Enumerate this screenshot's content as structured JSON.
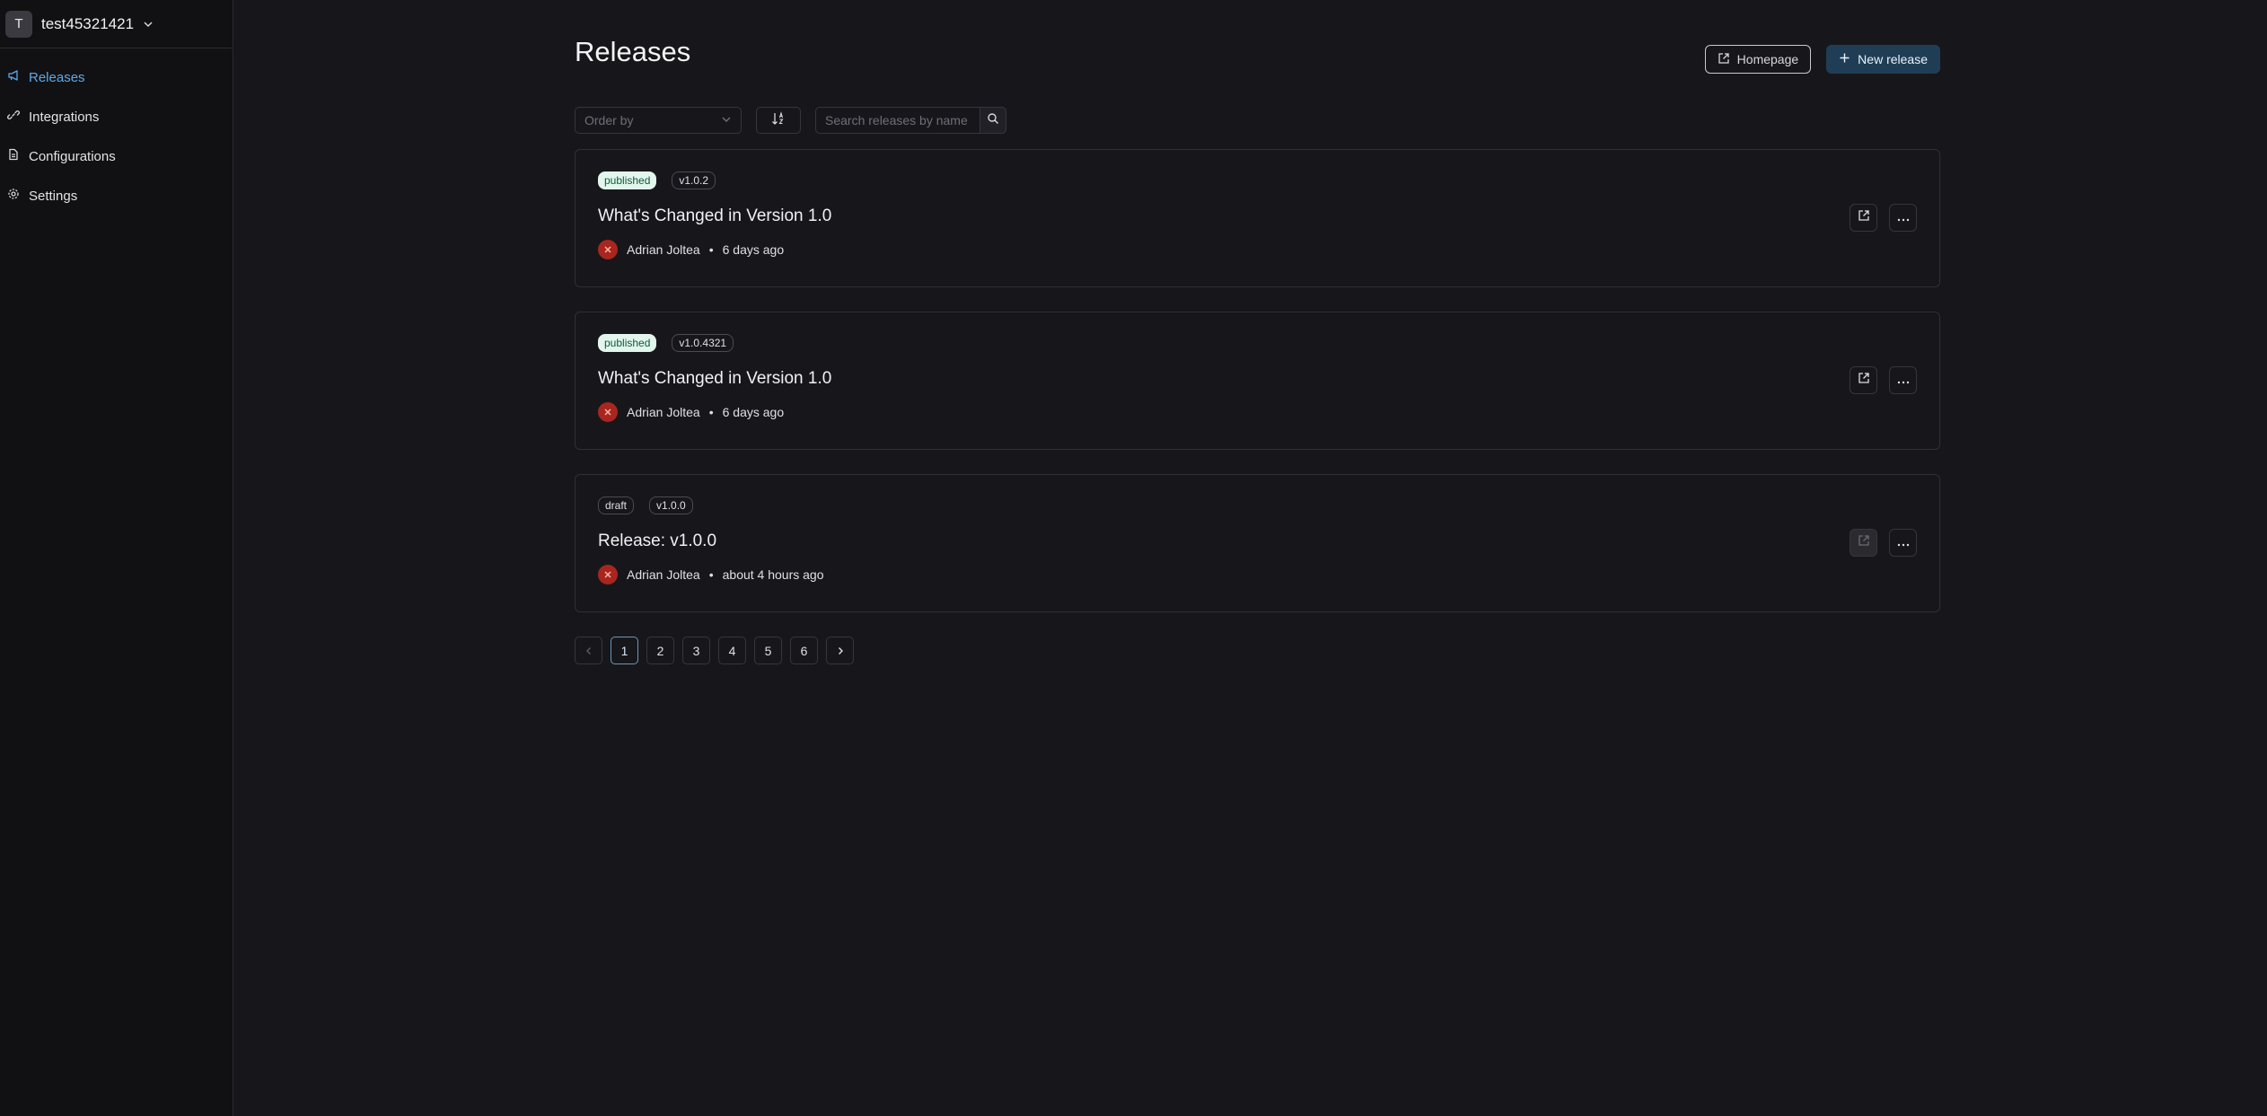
{
  "workspace": {
    "initial": "T",
    "name": "test45321421"
  },
  "sidebar": {
    "items": [
      {
        "label": "Releases",
        "icon": "megaphone-icon",
        "active": true
      },
      {
        "label": "Integrations",
        "icon": "link-icon"
      },
      {
        "label": "Configurations",
        "icon": "file-icon"
      },
      {
        "label": "Settings",
        "icon": "gear-icon"
      }
    ]
  },
  "header": {
    "title": "Releases",
    "homepage_label": "Homepage",
    "new_release_label": "New release"
  },
  "toolbar": {
    "order_placeholder": "Order by",
    "search_placeholder": "Search releases by name"
  },
  "releases": [
    {
      "status": "published",
      "version": "v1.0.2",
      "title": "What's Changed in Version 1.0",
      "author": "Adrian Joltea",
      "time": "6 days ago"
    },
    {
      "status": "published",
      "version": "v1.0.4321",
      "title": "What's Changed in Version 1.0",
      "author": "Adrian Joltea",
      "time": "6 days ago"
    },
    {
      "status": "draft",
      "version": "v1.0.0",
      "title": "Release: v1.0.0",
      "author": "Adrian Joltea",
      "time": "about 4 hours ago"
    }
  ],
  "pagination": {
    "pages": [
      "1",
      "2",
      "3",
      "4",
      "5",
      "6"
    ],
    "current": "1"
  },
  "colors": {
    "accent": "#5fa8e8",
    "primary_button": "#1f3e56",
    "published_badge": "#e2f6ee",
    "avatar": "#a8261f"
  }
}
